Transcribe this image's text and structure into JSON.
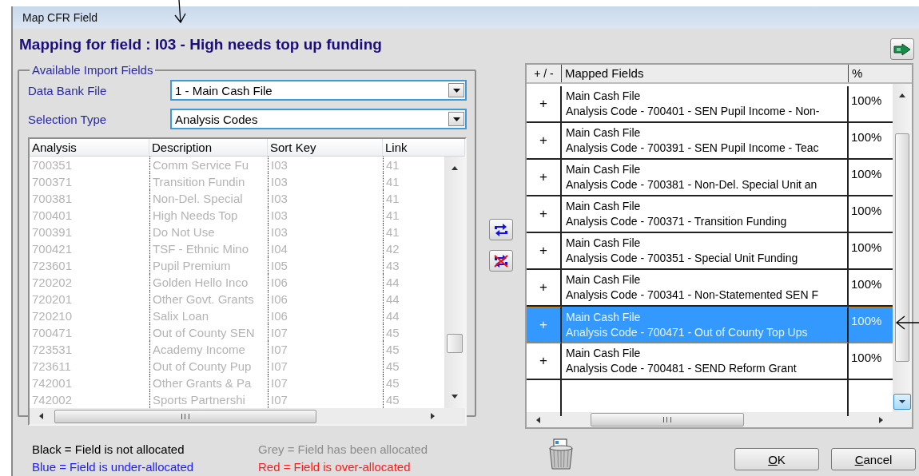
{
  "window": {
    "title": "Map CFR Field"
  },
  "heading": "Mapping for field : I03 - High needs top up funding",
  "import_fields": {
    "legend": "Available Import Fields",
    "selectors": [
      {
        "label": "Data Bank File",
        "value": "1 - Main Cash File"
      },
      {
        "label": "Selection Type",
        "value": "Analysis Codes"
      }
    ],
    "columns": [
      "Analysis",
      "Description",
      "Sort Key",
      "Link"
    ],
    "rows": [
      {
        "cells": [
          "700351",
          "Comm Service Fu",
          "I03",
          "41"
        ],
        "allocated": true
      },
      {
        "cells": [
          "700371",
          "Transition Fundin",
          "I03",
          "41"
        ],
        "allocated": true
      },
      {
        "cells": [
          "700381",
          "Non-Del. Special",
          "I03",
          "41"
        ],
        "allocated": true
      },
      {
        "cells": [
          "700401",
          "High Needs Top",
          "I03",
          "41"
        ],
        "allocated": true
      },
      {
        "cells": [
          "700391",
          "Do Not Use",
          "I03",
          "41"
        ],
        "allocated": true
      },
      {
        "cells": [
          "700421",
          "TSF - Ethnic Mino",
          "I04",
          "42"
        ],
        "allocated": true
      },
      {
        "cells": [
          "723601",
          "Pupil Premium",
          "I05",
          "43"
        ],
        "allocated": true
      },
      {
        "cells": [
          "720202",
          "Golden Hello Inco",
          "I06",
          "44"
        ],
        "allocated": true
      },
      {
        "cells": [
          "720201",
          "Other Govt. Grants",
          "I06",
          "44"
        ],
        "allocated": true
      },
      {
        "cells": [
          "720210",
          "Salix Loan",
          "I06",
          "44"
        ],
        "allocated": true
      },
      {
        "cells": [
          "700471",
          "Out of County SEN",
          "I07",
          "45"
        ],
        "allocated": true
      },
      {
        "cells": [
          "723531",
          "Academy Income",
          "I07",
          "45"
        ],
        "allocated": true
      },
      {
        "cells": [
          "723611",
          "Out of County Pup",
          "I07",
          "45"
        ],
        "allocated": true
      },
      {
        "cells": [
          "742001",
          "Other Grants & Pa",
          "I07",
          "45"
        ],
        "allocated": true
      },
      {
        "cells": [
          "742002",
          "Sports Partnershi",
          "I07",
          "45"
        ],
        "allocated": true
      }
    ]
  },
  "mapped_fields": {
    "columns": [
      "+ / -",
      "Mapped Fields",
      "%"
    ],
    "rows": [
      {
        "sign": "+",
        "file": "Main Cash File",
        "code": "Analysis Code - 700401 - SEN Pupil Income - Non-",
        "percent": "100%",
        "selected": false
      },
      {
        "sign": "+",
        "file": "Main Cash File",
        "code": "Analysis Code - 700391 - SEN Pupil Income - Teac",
        "percent": "100%",
        "selected": false
      },
      {
        "sign": "+",
        "file": "Main Cash File",
        "code": "Analysis Code - 700381 - Non-Del. Special Unit an",
        "percent": "100%",
        "selected": false
      },
      {
        "sign": "+",
        "file": "Main Cash File",
        "code": "Analysis Code - 700371 - Transition Funding",
        "percent": "100%",
        "selected": false
      },
      {
        "sign": "+",
        "file": "Main Cash File",
        "code": "Analysis Code - 700351 - Special Unit Funding",
        "percent": "100%",
        "selected": false
      },
      {
        "sign": "+",
        "file": "Main Cash File",
        "code": "Analysis Code - 700341 - Non-Statemented SEN F",
        "percent": "100%",
        "selected": false
      },
      {
        "sign": "+",
        "file": "Main Cash File",
        "code": "Analysis Code - 700471 - Out of County Top Ups",
        "percent": "100%",
        "selected": true
      },
      {
        "sign": "+",
        "file": "Main Cash File",
        "code": "Analysis Code - 700481 - SEND Reform Grant",
        "percent": "100%",
        "selected": false
      }
    ]
  },
  "legend": [
    {
      "text": "Black = Field is not allocated",
      "color": "#000000"
    },
    {
      "text": "Grey = Field has been allocated",
      "color": "#8c8c8c"
    },
    {
      "text": "Blue = Field is under-allocated",
      "color": "#1a1aff"
    },
    {
      "text": "Red = Field is over-allocated",
      "color": "#ff1a1a"
    }
  ],
  "buttons": [
    "OK",
    "Cancel"
  ]
}
